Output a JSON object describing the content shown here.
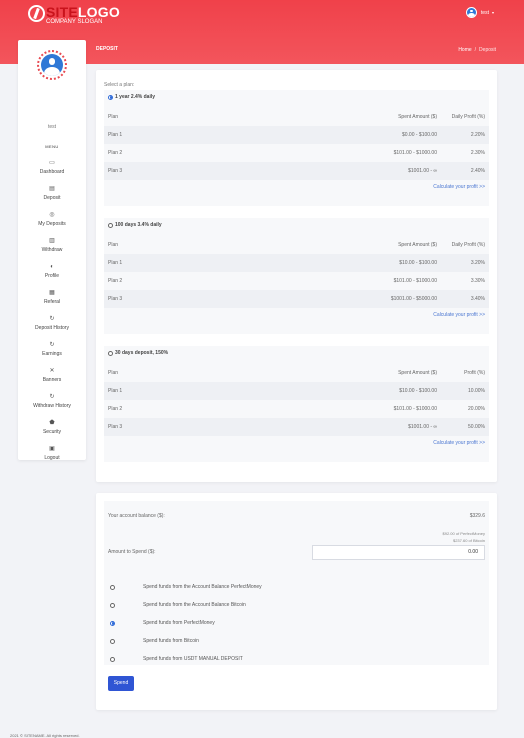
{
  "header": {
    "logo_site": "SITE",
    "logo_logo": "LOGO",
    "slogan": "COMPANY SLOGAN",
    "user": "test"
  },
  "sidebar": {
    "user_name": "test",
    "menu_label": "MENU",
    "items": [
      {
        "label": "Dashboard",
        "icon": "monitor-icon",
        "glyph": "▭"
      },
      {
        "label": "Deposit",
        "icon": "deposit-icon",
        "glyph": "▤"
      },
      {
        "label": "My Deposits",
        "icon": "coins-icon",
        "glyph": "◎"
      },
      {
        "label": "Withdraw",
        "icon": "withdraw-icon",
        "glyph": "▥"
      },
      {
        "label": "Profile",
        "icon": "profile-icon",
        "glyph": "◐"
      },
      {
        "label": "Referal",
        "icon": "calendar-icon",
        "glyph": "▦"
      },
      {
        "label": "Deposit History",
        "icon": "history-icon",
        "glyph": "↻"
      },
      {
        "label": "Earnings",
        "icon": "earnings-icon",
        "glyph": "↻"
      },
      {
        "label": "Banners",
        "icon": "tools-icon",
        "glyph": "✕"
      },
      {
        "label": "Withdraw History",
        "icon": "withdraw-history-icon",
        "glyph": "↻"
      },
      {
        "label": "Security",
        "icon": "shield-icon",
        "glyph": "⬟"
      },
      {
        "label": "Logout",
        "icon": "logout-icon",
        "glyph": "▣"
      }
    ]
  },
  "page": {
    "title": "DEPOSIT",
    "breadcrumb_home": "Home",
    "breadcrumb_sep": "/",
    "breadcrumb_current": "Deposit"
  },
  "plans": {
    "select_label": "Select a plan:",
    "groups": [
      {
        "title": "1 year 2.4% daily",
        "selected": true,
        "headers": [
          "Plan",
          "Spent Amount ($)",
          "Daily Profit (%)"
        ],
        "rows": [
          [
            "Plan 1",
            "$0.00 - $100.00",
            "2.20%"
          ],
          [
            "Plan 2",
            "$101.00 - $1000.00",
            "2.30%"
          ],
          [
            "Plan 3",
            "$1001.00 - ∞",
            "2.40%"
          ]
        ],
        "calc": "Calculate your profit >>"
      },
      {
        "title": "100 days 3.4% daily",
        "selected": false,
        "headers": [
          "Plan",
          "Spent Amount ($)",
          "Daily Profit (%)"
        ],
        "rows": [
          [
            "Plan 1",
            "$10.00 - $100.00",
            "3.20%"
          ],
          [
            "Plan 2",
            "$101.00 - $1000.00",
            "3.30%"
          ],
          [
            "Plan 3",
            "$1001.00 - $5000.00",
            "3.40%"
          ]
        ],
        "calc": "Calculate your profit >>"
      },
      {
        "title": "30 days deposit, 150%",
        "selected": false,
        "headers": [
          "Plan",
          "Spent Amount ($)",
          "Profit (%)"
        ],
        "rows": [
          [
            "Plan 1",
            "$10.00 - $100.00",
            "10.00%"
          ],
          [
            "Plan 2",
            "$101.00 - $1000.00",
            "20.00%"
          ],
          [
            "Plan 3",
            "$1001.00 - ∞",
            "50.00%"
          ]
        ],
        "calc": "Calculate your profit >>"
      }
    ]
  },
  "spend": {
    "balance_label": "Your account balance ($):",
    "balance_value": "$329.6",
    "balance_pm": "$92.00 of PerfectMoney",
    "balance_btc": "$237.60 of Bitcoin",
    "amount_label": "Amount to Spend ($):",
    "amount_value": "0.00",
    "options": [
      {
        "label": "Spend funds from the Account Balance PerfectMoney",
        "selected": false
      },
      {
        "label": "Spend funds from the Account Balance Bitcoin",
        "selected": false
      },
      {
        "label": "Spend funds from PerfectMoney",
        "selected": true
      },
      {
        "label": "Spend funds from Bitcoin",
        "selected": false
      },
      {
        "label": "Spend funds from USDT MANUAL DEPOSIT",
        "selected": false
      }
    ],
    "button": "Spend"
  },
  "footer": {
    "text": "2021 © SITENAME. All rights reserved."
  },
  "colors": {
    "header_red": "#f0414a",
    "accent_blue": "#2f55d4",
    "link_blue": "#4a76d1"
  }
}
